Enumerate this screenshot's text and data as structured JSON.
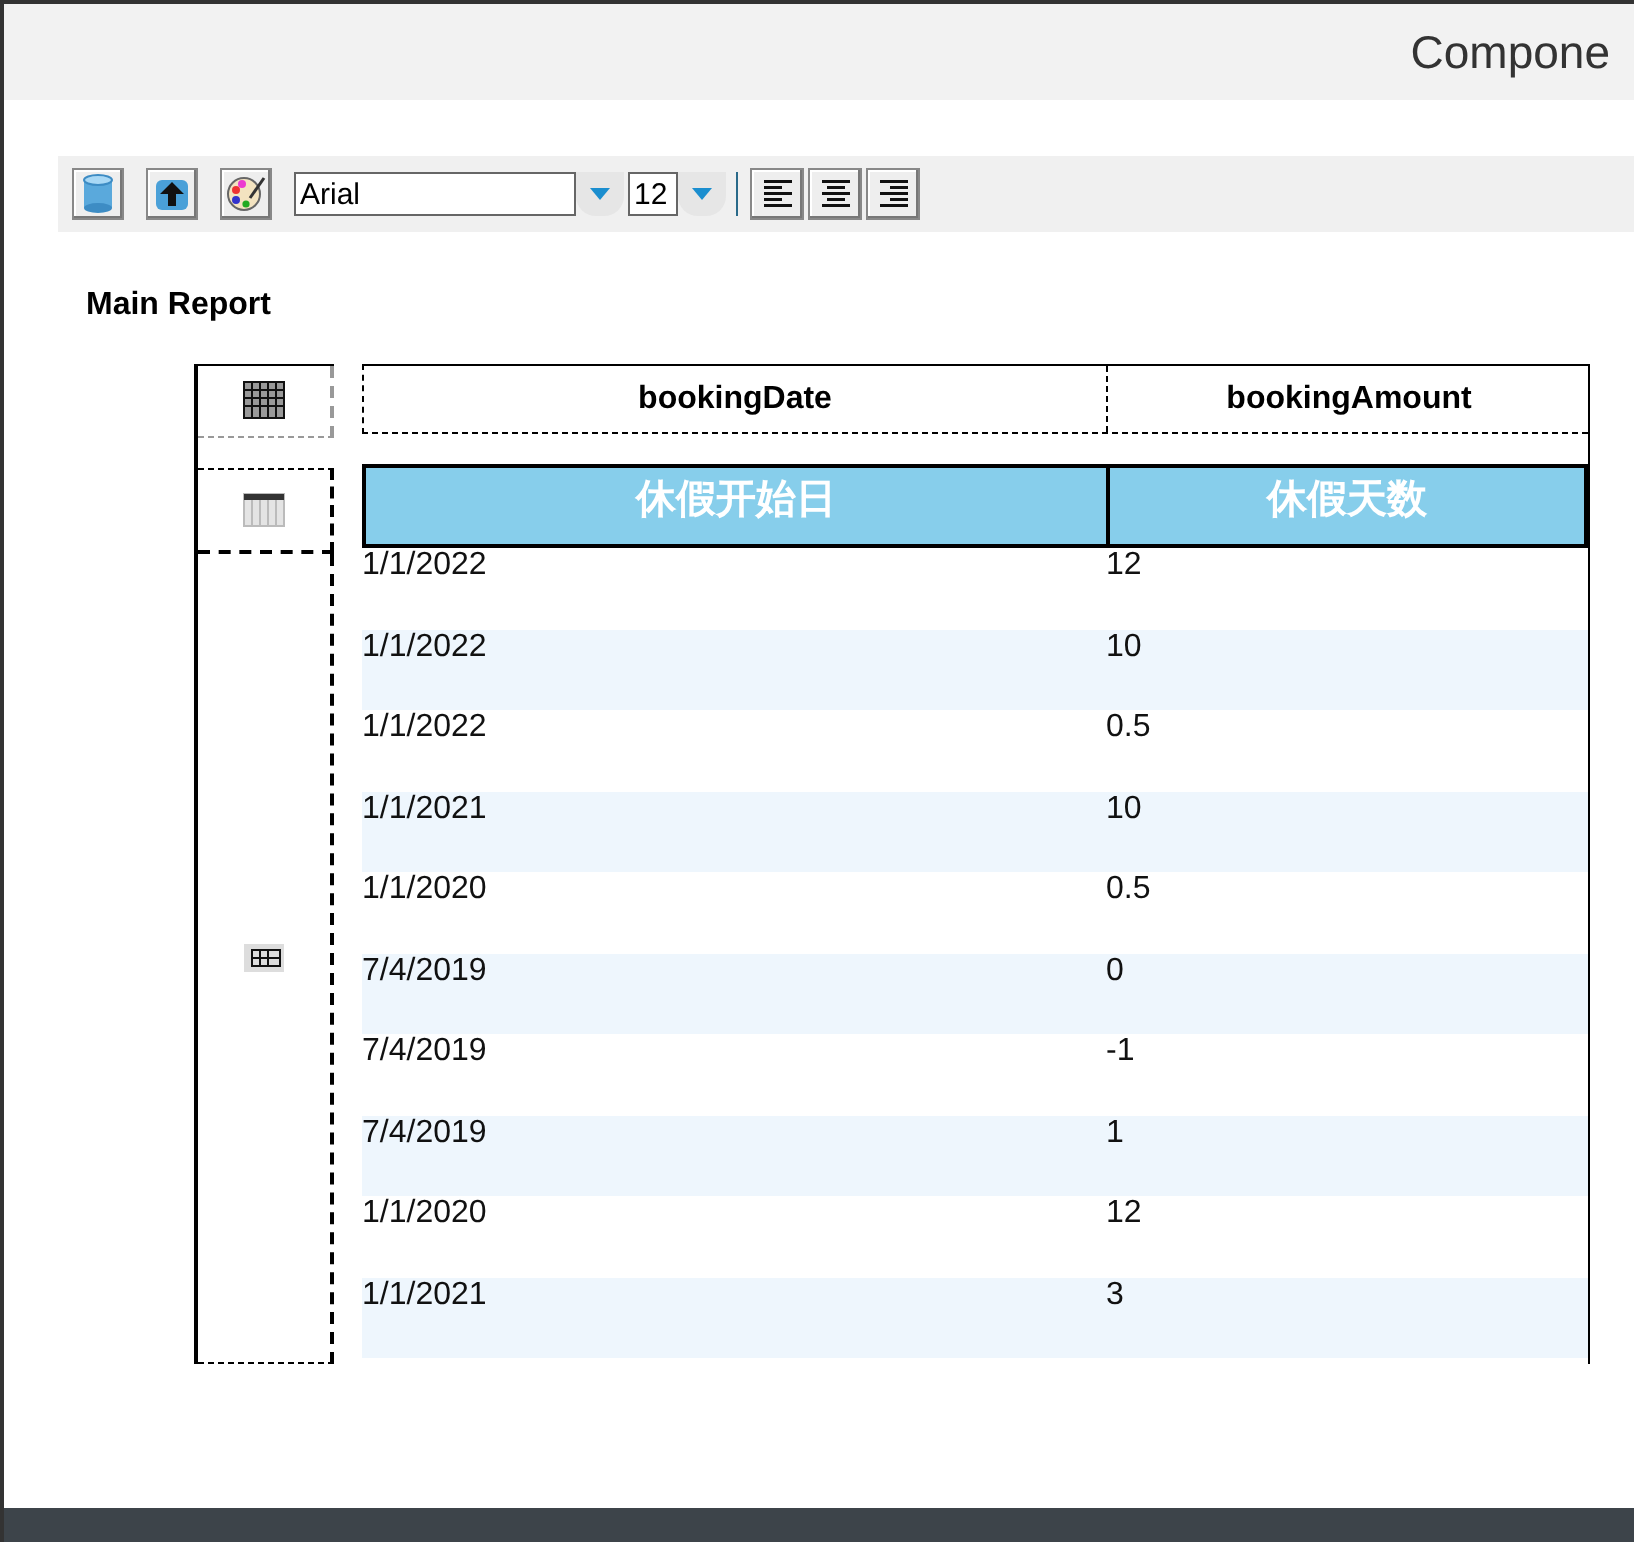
{
  "window": {
    "title": "Compone"
  },
  "toolbar": {
    "font": "Arial",
    "size": "12"
  },
  "report": {
    "title": "Main Report",
    "columns": [
      "bookingDate",
      "bookingAmount"
    ],
    "headers": [
      "休假开始日",
      "休假天数"
    ],
    "rows": [
      [
        "1/1/2022",
        "12"
      ],
      [
        "1/1/2022",
        "10"
      ],
      [
        "1/1/2022",
        "0.5"
      ],
      [
        "1/1/2021",
        "10"
      ],
      [
        "1/1/2020",
        "0.5"
      ],
      [
        "7/4/2019",
        "0"
      ],
      [
        "7/4/2019",
        "-1"
      ],
      [
        "7/4/2019",
        "1"
      ],
      [
        "1/1/2020",
        "12"
      ],
      [
        "1/1/2021",
        "3"
      ]
    ]
  }
}
